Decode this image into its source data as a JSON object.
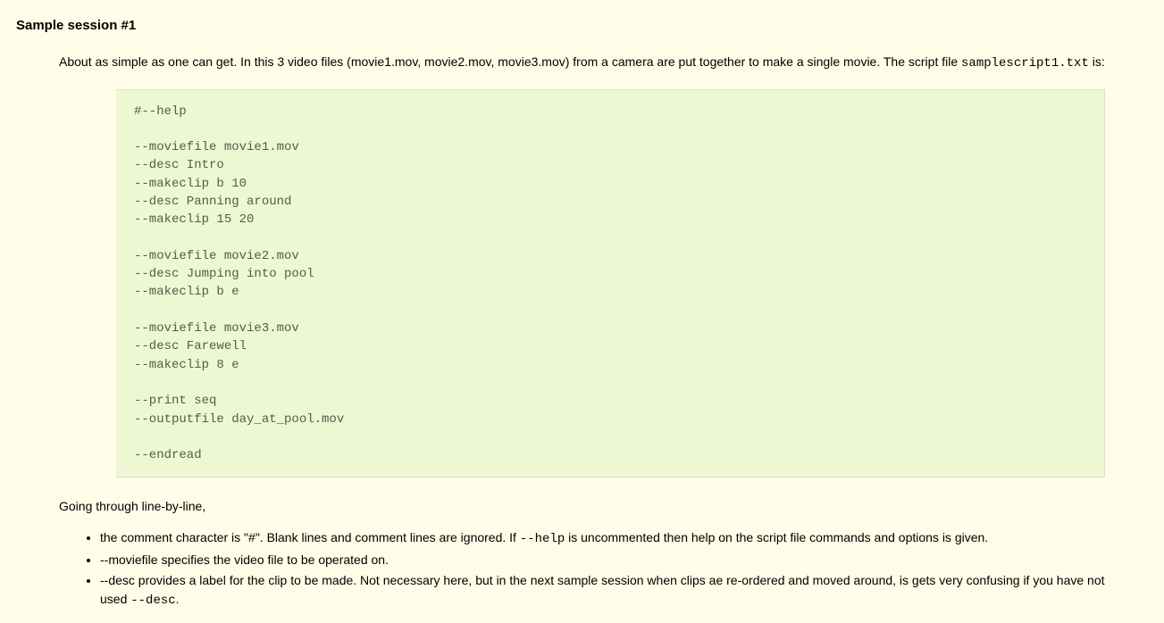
{
  "heading": "Sample session #1",
  "intro": {
    "before_code": "About as simple as one can get. In this 3 video files (movie1.mov, movie2.mov, movie3.mov) from a camera are put together to make a single movie. The script file ",
    "script_filename": "samplescript1.txt",
    "after_code": " is:"
  },
  "codeblock": "#--help\n\n--moviefile movie1.mov\n--desc Intro\n--makeclip b 10\n--desc Panning around\n--makeclip 15 20\n\n--moviefile movie2.mov\n--desc Jumping into pool\n--makeclip b e\n\n--moviefile movie3.mov\n--desc Farewell\n--makeclip 8 e\n\n--print seq\n--outputfile day_at_pool.mov\n\n--endread",
  "after_label": "Going through line-by-line,",
  "bullets": {
    "b1_a": "the comment character is \"#\". Blank lines and comment lines are ignored. If ",
    "b1_code": "--help",
    "b1_b": " is uncommented then help on the script file commands and options is given.",
    "b2": "--moviefile specifies the video file to be operated on.",
    "b3_a": "--desc provides a label for the clip to be made. Not necessary here, but in the next sample session when clips ae re-ordered and moved around, is gets very confusing if you have not used ",
    "b3_code": "--desc",
    "b3_b": "."
  }
}
